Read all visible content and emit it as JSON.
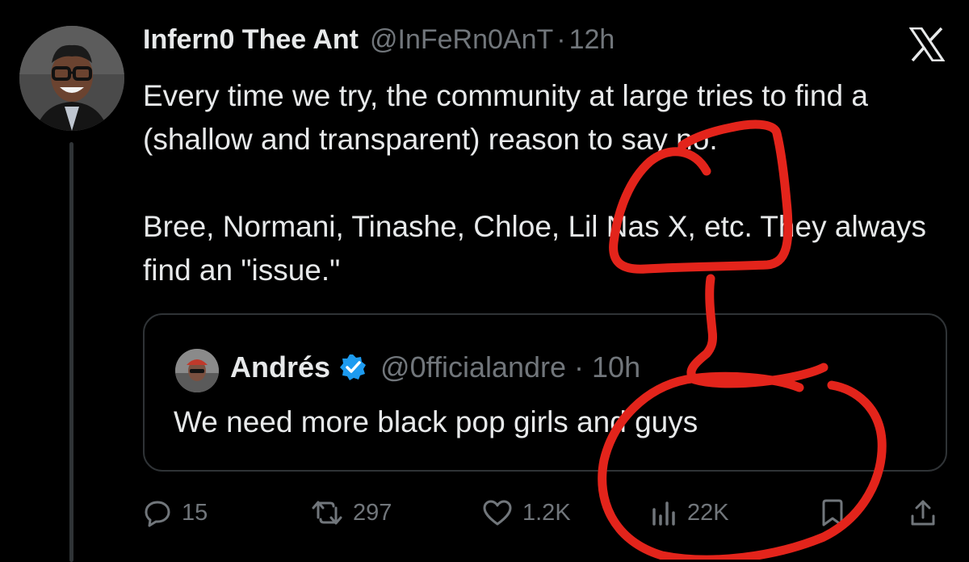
{
  "tweet": {
    "author_name": "Infern0 Thee Ant",
    "author_handle": "@InFeRn0AnT",
    "separator": "·",
    "timestamp": "12h",
    "text_lines": [
      "Every time we try, the community at large tries to find a (shallow and transparent) reason to say no.",
      "Bree, Normani, Tinashe, Chloe, Lil Nas X, etc. They always find an \"issue.\""
    ]
  },
  "quote": {
    "author_name": "Andrés",
    "author_handle": "@0fficialandre · 10h",
    "text": "We need more black pop girls and guys"
  },
  "actions": {
    "replies": "15",
    "reposts": "297",
    "likes": "1.2K",
    "views": "22K"
  },
  "icons": {
    "brand": "x-logo-icon",
    "verified": "verified-badge-icon",
    "reply": "reply-icon",
    "repost": "repost-icon",
    "like": "heart-icon",
    "views": "views-icon",
    "bookmark": "bookmark-icon",
    "share": "share-icon"
  },
  "colors": {
    "background": "#000000",
    "text": "#e7e9ea",
    "muted": "#71767b",
    "border": "#2f3336",
    "verified": "#1d9bf0",
    "annotation": "#e3241b"
  }
}
